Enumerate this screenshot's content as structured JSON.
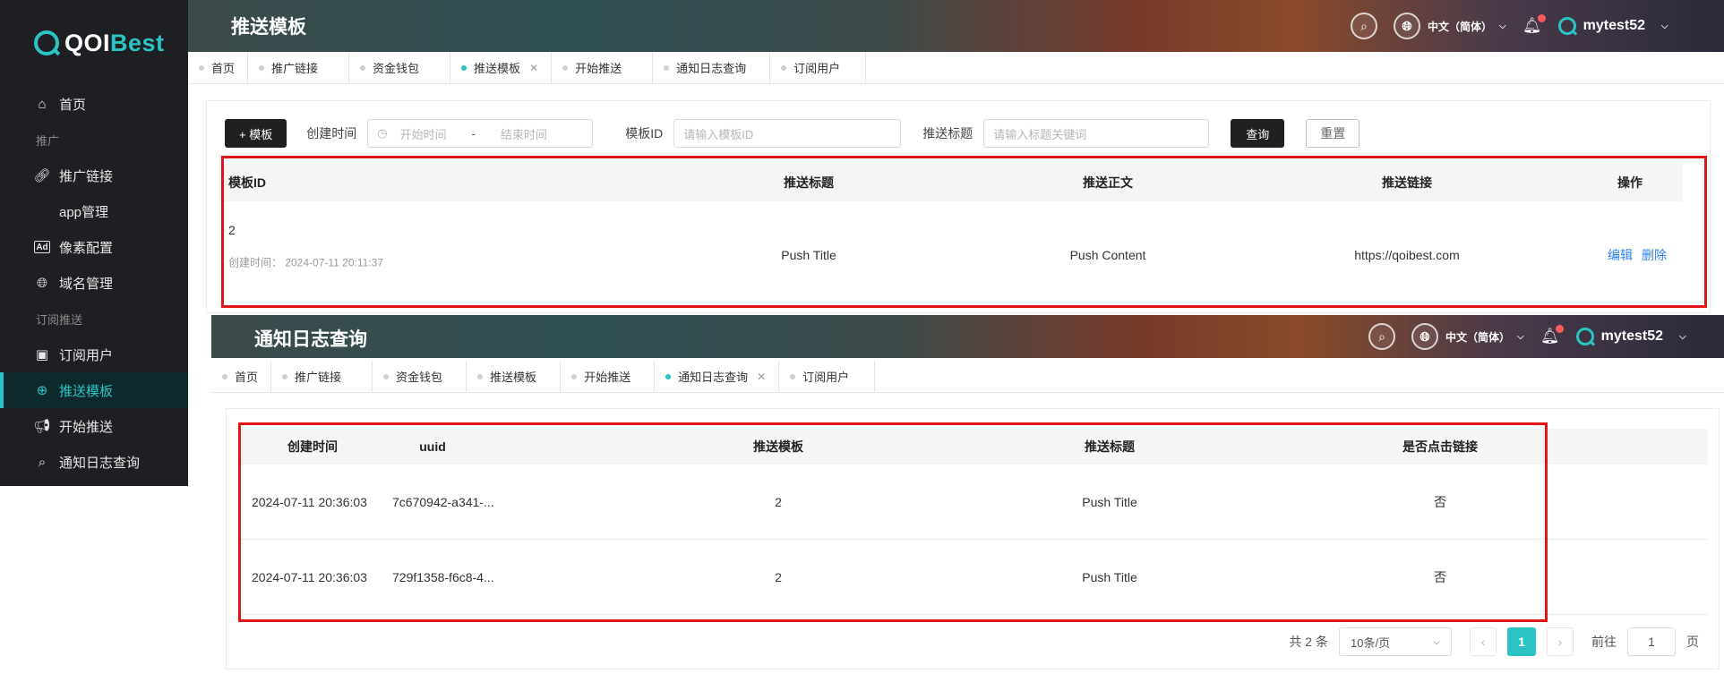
{
  "brand": {
    "logo_q": "QOI",
    "logo_b": "Best"
  },
  "sidebar": {
    "home": "首页",
    "group_promo": "推广",
    "items_promo": [
      "推广链接",
      "app管理",
      "像素配置",
      "域名管理"
    ],
    "group_sub": "订阅推送",
    "items_sub": [
      "订阅用户",
      "推送模板",
      "开始推送",
      "通知日志查询"
    ]
  },
  "header1": {
    "title": "推送模板",
    "lang": "中文（简体）",
    "user": "mytest52"
  },
  "header2": {
    "title": "通知日志查询",
    "lang": "中文（简体）",
    "user": "mytest52"
  },
  "tabs1": [
    "首页",
    "推广链接",
    "资金钱包",
    "推送模板",
    "开始推送",
    "通知日志查询",
    "订阅用户"
  ],
  "tabs2": [
    "首页",
    "推广链接",
    "资金钱包",
    "推送模板",
    "开始推送",
    "通知日志查询",
    "订阅用户"
  ],
  "filters": {
    "add_btn": "+ 模板",
    "created_label": "创建时间",
    "start_ph": "开始时间",
    "sep": "-",
    "end_ph": "结束时间",
    "tid_label": "模板ID",
    "tid_ph": "请输入模板ID",
    "title_label": "推送标题",
    "title_ph": "请输入标题关键词",
    "query_btn": "查询",
    "reset_btn": "重置"
  },
  "table1": {
    "headers": [
      "模板ID",
      "推送标题",
      "推送正文",
      "推送链接",
      "操作"
    ],
    "row": {
      "id": "2",
      "created": "创建时间：  2024-07-11 20:11:37",
      "title": "Push Title",
      "content": "Push Content",
      "link": "https://qoibest.com",
      "edit": "编辑",
      "delete": "删除"
    }
  },
  "table2": {
    "headers": [
      "创建时间",
      "uuid",
      "推送模板",
      "推送标题",
      "是否点击链接"
    ],
    "rows": [
      {
        "time": "2024-07-11 20:36:03",
        "uuid": "7c670942-a341-...",
        "tpl": "2",
        "title": "Push Title",
        "clicked": "否"
      },
      {
        "time": "2024-07-11 20:36:03",
        "uuid": "729f1358-f6c8-4...",
        "tpl": "2",
        "title": "Push Title",
        "clicked": "否"
      }
    ]
  },
  "pager": {
    "total": "共 2 条",
    "size": "10条/页",
    "current": "1",
    "goto": "前往",
    "goto_val": "1",
    "page_unit": "页"
  }
}
